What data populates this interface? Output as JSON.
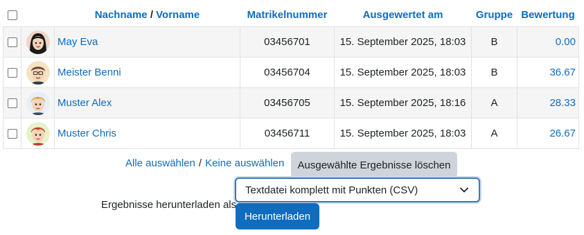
{
  "table": {
    "headers": {
      "lastname": "Nachname",
      "name_separator": "/",
      "firstname": "Vorname",
      "idnumber": "Matrikelnummer",
      "evaluated": "Ausgewertet am",
      "group": "Gruppe",
      "grade": "Bewertung"
    },
    "rows": [
      {
        "name": "May Eva",
        "idnumber": "03456701",
        "evaluated": "15. September 2025, 18:03",
        "group": "B",
        "grade": "0.00",
        "avatar": "female-avatar-black-hair"
      },
      {
        "name": "Meister Benni",
        "idnumber": "03456704",
        "evaluated": "15. September 2025, 18:03",
        "group": "B",
        "grade": "36.67",
        "avatar": "male-avatar-glasses"
      },
      {
        "name": "Muster Alex",
        "idnumber": "03456705",
        "evaluated": "15. September 2025, 18:16",
        "group": "A",
        "grade": "28.33",
        "avatar": "male-avatar-blond"
      },
      {
        "name": "Muster Chris",
        "idnumber": "03456711",
        "evaluated": "15. September 2025, 18:03",
        "group": "A",
        "grade": "26.67",
        "avatar": "male-avatar-red-hair"
      }
    ]
  },
  "selection": {
    "select_all": "Alle auswählen",
    "separator": "/",
    "select_none": "Keine auswählen",
    "delete_button": "Ausgewählte Ergebnisse löschen"
  },
  "download": {
    "label": "Ergebnisse herunterladen als:",
    "format_selected": "Textdatei komplett mit Punkten (CSV)",
    "button": "Herunterladen"
  },
  "colors": {
    "link": "#0f6cbf",
    "primary_button": "#0f6cbf",
    "secondary_button": "#ced4da",
    "row_stripe": "#f5f5f5"
  }
}
